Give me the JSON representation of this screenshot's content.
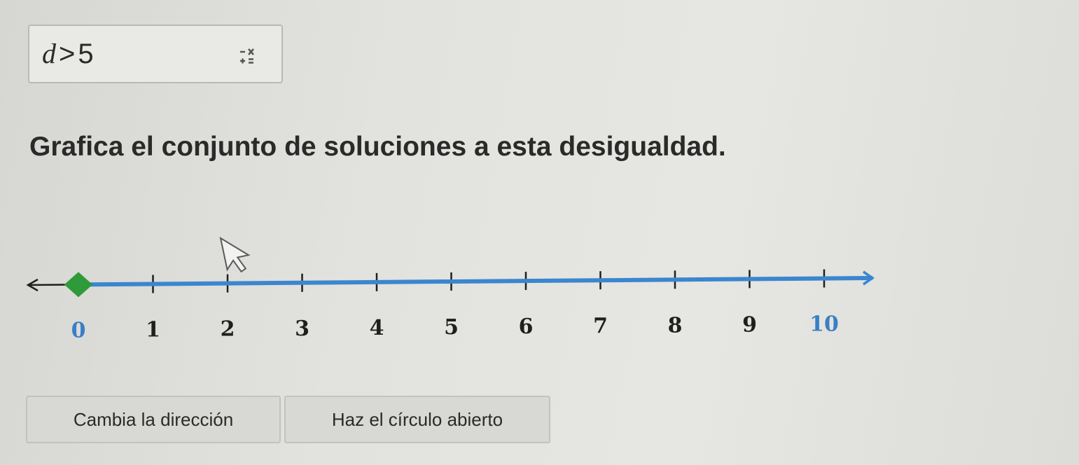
{
  "answer_box": {
    "variable": "d",
    "operator": ">",
    "value": "5",
    "keypad_icon": "math-keypad-icon"
  },
  "prompt": "Grafica el conjunto de soluciones a esta desigualdad.",
  "number_line": {
    "tick_labels": [
      "0",
      "1",
      "2",
      "3",
      "4",
      "5",
      "6",
      "7",
      "8",
      "9",
      "10"
    ],
    "point_value": 0,
    "point_type": "closed",
    "ray_direction": "right",
    "colors": {
      "axis": "#1f1f1f",
      "ray": "#3a86cf",
      "point": "#2f9a3a",
      "label_default": "#1f1f1f",
      "label_endpoint": "#3a7fc4"
    }
  },
  "buttons": {
    "change_direction": "Cambia la dirección",
    "open_circle": "Haz el círculo abierto"
  }
}
